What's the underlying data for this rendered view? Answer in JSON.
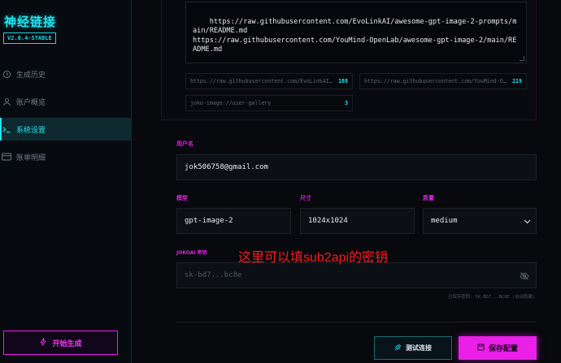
{
  "sidebar": {
    "brand": "神经链接",
    "version": "V2.0.4-STABLE",
    "items": [
      {
        "label": "生成历史",
        "icon": "history-icon"
      },
      {
        "label": "账户概览",
        "icon": "user-icon"
      },
      {
        "label": "系统设置",
        "icon": "terminal-icon"
      },
      {
        "label": "账单明细",
        "icon": "card-icon"
      }
    ],
    "active_index": 2,
    "start_label": "开始生成"
  },
  "sources": {
    "textarea": "https://raw.githubusercontent.com/EvoLinkAI/awesome-gpt-image-2-prompts/main/README.md\nhttps://raw.githubusercontent.com/YouMind-OpenLab/awesome-gpt-image-2/main/README.md",
    "items": [
      {
        "label": "https://raw.githubusercontent.com/EvoLinkAI/...",
        "count": "188"
      },
      {
        "label": "https://raw.githubusercontent.com/YouMind-OpenLab/...",
        "count": "219"
      },
      {
        "label": "joko-image://user-gallery",
        "count": "3"
      }
    ]
  },
  "form": {
    "username_label": "用户名",
    "username_value": "jok506758@gmail.com",
    "model_label": "模型",
    "model_value": "gpt-image-2",
    "size_label": "尺寸",
    "size_value": "1024x1024",
    "quality_label": "质量",
    "quality_value": "medium",
    "apikey_label": "JOKOAI 密钥",
    "apikey_value": "sk-bd7...bc8e",
    "saved_hint": "已保存密钥: SK-BD7...BC8E (自动隐藏)"
  },
  "annotation": "这里可以填sub2api的密钥",
  "actions": {
    "test_label": "测试连接",
    "save_label": "保存配置"
  },
  "colors": {
    "cyan": "#22e3f0",
    "magenta": "#ea1fe8",
    "background": "#07090d"
  }
}
